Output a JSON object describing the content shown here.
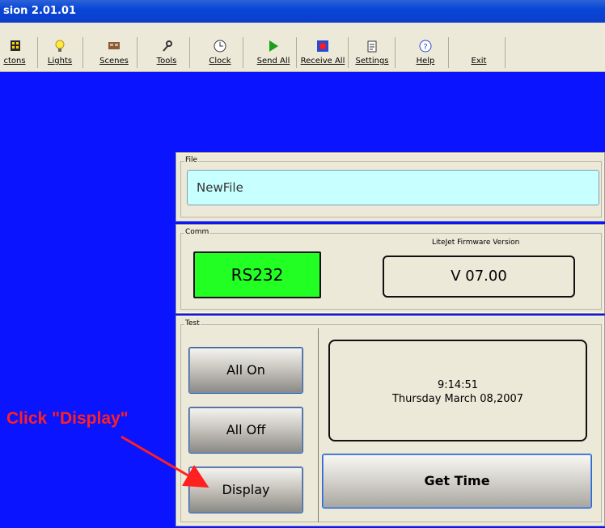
{
  "window": {
    "title": "sion 2.01.01"
  },
  "toolbar": {
    "items": [
      {
        "label": "ctons",
        "icon": "grid-icon"
      },
      {
        "label": "Lights",
        "icon": "lightbulb-icon"
      },
      {
        "label": "Scenes",
        "icon": "scenes-icon"
      },
      {
        "label": "Tools",
        "icon": "tools-icon"
      },
      {
        "label": "Clock",
        "icon": "clock-icon"
      },
      {
        "label": "Send All",
        "icon": "play-icon"
      },
      {
        "label": "Receive All",
        "icon": "record-icon"
      },
      {
        "label": "Settings",
        "icon": "settings-icon"
      },
      {
        "label": "Help",
        "icon": "help-icon"
      },
      {
        "label": "Exit",
        "icon": ""
      }
    ]
  },
  "file": {
    "legend": "File",
    "value": "NewFile"
  },
  "comm": {
    "legend": "Comm",
    "status": "RS232",
    "status_color": "#22ff22",
    "firmware_label": "LiteJet Firmware Version",
    "firmware_value": "V 07.00"
  },
  "test": {
    "legend": "Test",
    "all_on": "All On",
    "all_off": "All Off",
    "display": "Display",
    "time": "9:14:51",
    "date": "Thursday  March 08,2007",
    "get_time": "Get Time"
  },
  "annotation": {
    "text": "Click \"Display\"",
    "color": "#ff2020"
  }
}
